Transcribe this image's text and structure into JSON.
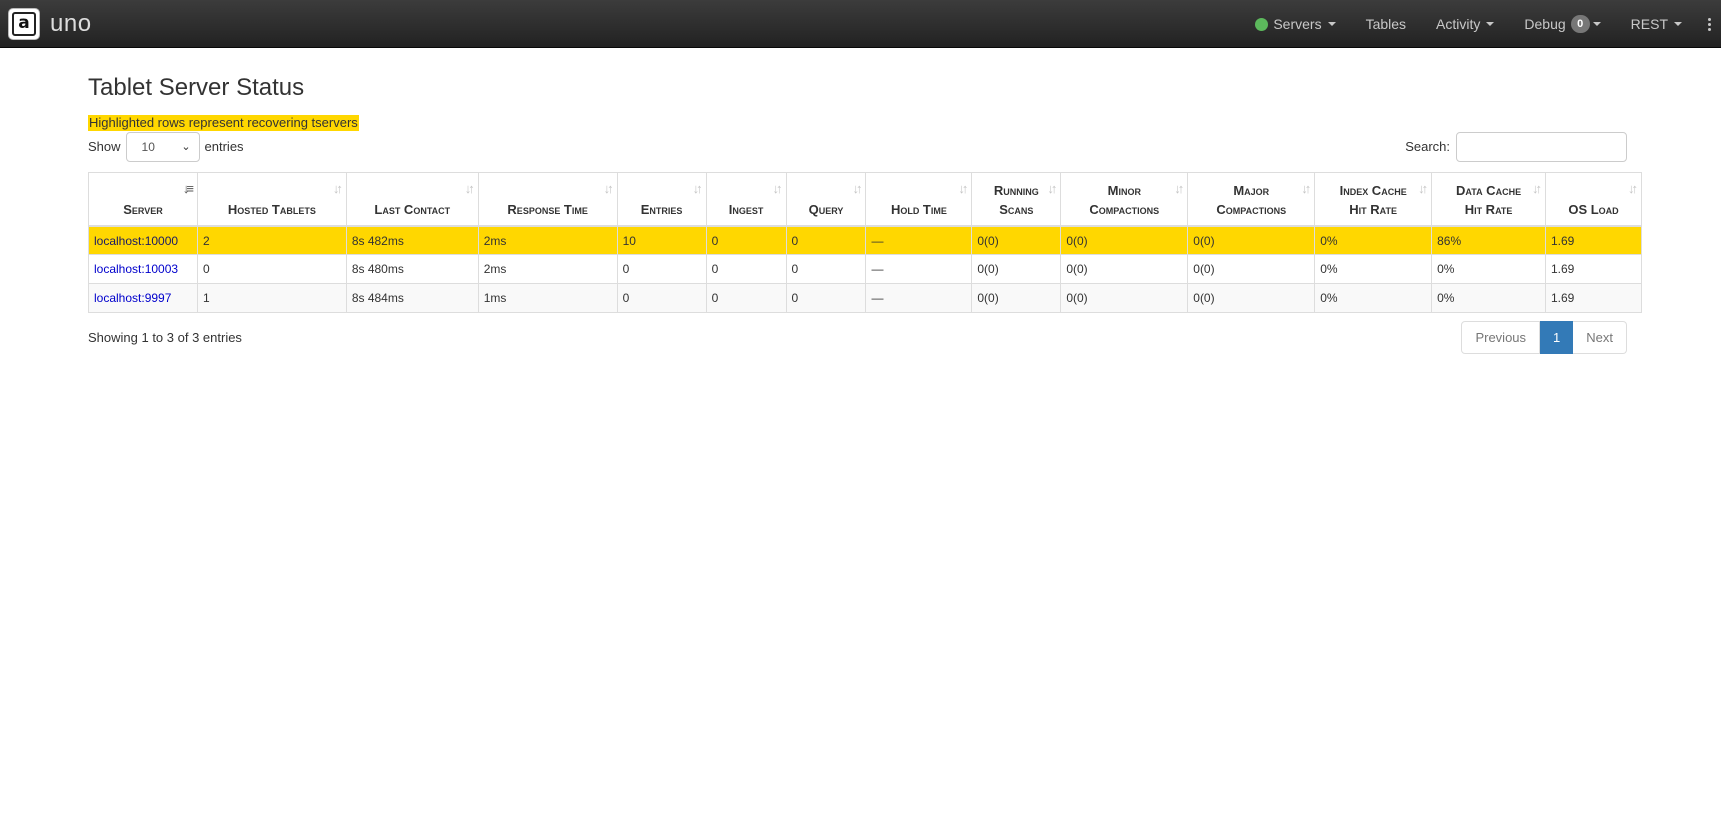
{
  "navbar": {
    "brand_logo_letter": "a",
    "brand_name": "uno",
    "items": [
      {
        "label": "Servers",
        "status_color": "#5cb85c"
      },
      {
        "label": "Tables"
      },
      {
        "label": "Activity"
      },
      {
        "label": "Debug",
        "badge": "0"
      },
      {
        "label": "REST"
      }
    ]
  },
  "page": {
    "title": "Tablet Server Status",
    "legend": "Highlighted rows represent recovering tservers",
    "highlight_color": "#ffd700"
  },
  "controls": {
    "show_label": "Show",
    "length_value": "10",
    "entries_label": "entries",
    "search_label": "Search:",
    "search_value": ""
  },
  "table": {
    "columns": [
      [
        "Server"
      ],
      [
        "Hosted Tablets"
      ],
      [
        "Last Contact"
      ],
      [
        "Response Time"
      ],
      [
        "Entries"
      ],
      [
        "Ingest"
      ],
      [
        "Query"
      ],
      [
        "Hold Time"
      ],
      [
        "Running",
        "Scans"
      ],
      [
        "Minor",
        "Compactions"
      ],
      [
        "Major",
        "Compactions"
      ],
      [
        "Index Cache",
        "Hit Rate"
      ],
      [
        "Data Cache",
        "Hit Rate"
      ],
      [
        "OS Load"
      ]
    ],
    "rows": [
      {
        "recovering": true,
        "cells": [
          "localhost:10000",
          "2",
          "8s 482ms",
          "2ms",
          "10",
          "0",
          "0",
          "—",
          "0(0)",
          "0(0)",
          "0(0)",
          "0%",
          "86%",
          "1.69"
        ]
      },
      {
        "recovering": false,
        "cells": [
          "localhost:10003",
          "0",
          "8s 480ms",
          "2ms",
          "0",
          "0",
          "0",
          "—",
          "0(0)",
          "0(0)",
          "0(0)",
          "0%",
          "0%",
          "1.69"
        ]
      },
      {
        "recovering": false,
        "cells": [
          "localhost:9997",
          "1",
          "8s 484ms",
          "1ms",
          "0",
          "0",
          "0",
          "—",
          "0(0)",
          "0(0)",
          "0(0)",
          "0%",
          "0%",
          "1.69"
        ]
      }
    ]
  },
  "footer": {
    "info": "Showing 1 to 3 of 3 entries",
    "previous": "Previous",
    "current_page": "1",
    "next": "Next"
  }
}
